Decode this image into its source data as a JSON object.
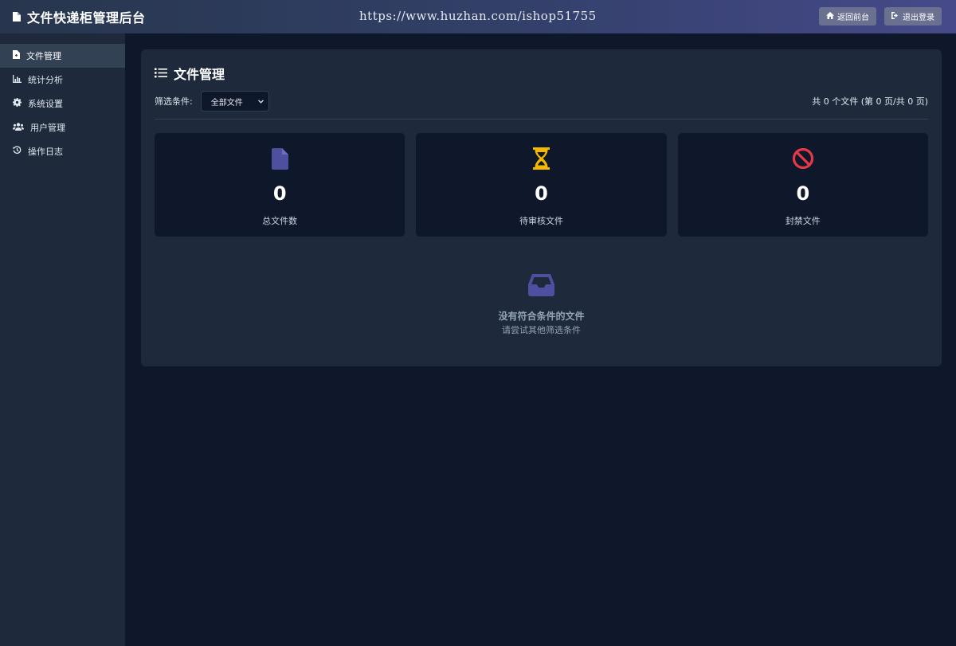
{
  "header": {
    "title": "文件快递柜管理后台",
    "watermark": "https://www.huzhan.com/ishop51755",
    "back_label": "返回前台",
    "logout_label": "退出登录"
  },
  "sidebar": {
    "items": [
      {
        "label": "文件管理",
        "icon": "file-icon",
        "active": true
      },
      {
        "label": "统计分析",
        "icon": "chart-icon",
        "active": false
      },
      {
        "label": "系统设置",
        "icon": "gear-icon",
        "active": false
      },
      {
        "label": "用户管理",
        "icon": "users-icon",
        "active": false
      },
      {
        "label": "操作日志",
        "icon": "history-icon",
        "active": false
      }
    ]
  },
  "main": {
    "title": "文件管理",
    "filter_label": "筛选条件:",
    "filter_selected": "全部文件",
    "count_text": "共 0 个文件 (第 0 页/共 0 页)",
    "stats": [
      {
        "value": "0",
        "label": "总文件数",
        "icon": "file-icon",
        "color": "#4f4f9f"
      },
      {
        "value": "0",
        "label": "待审核文件",
        "icon": "hourglass-icon",
        "color": "#f5b800"
      },
      {
        "value": "0",
        "label": "封禁文件",
        "icon": "ban-icon",
        "color": "#e53949"
      }
    ],
    "empty_title": "没有符合条件的文件",
    "empty_sub": "请尝试其他筛选条件"
  },
  "colors": {
    "bg": "#0f172a",
    "panel": "#1e293b",
    "accent": "#4f4f9f"
  }
}
